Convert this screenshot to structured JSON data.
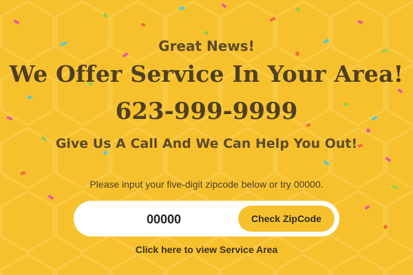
{
  "banner": {
    "pre_heading": "Great News!",
    "headline": "We Offer Service In Your Area!",
    "phone": "623-999-9999",
    "subheading": "Give Us A Call And We Can Help You Out!",
    "hint": "Please input your five-digit zipcode below or try 00000."
  },
  "zip_form": {
    "value": "00000",
    "button_label": "Check ZipCode"
  },
  "link": {
    "service_area": "Click here to view Service Area"
  },
  "colors": {
    "background": "#F7C12E",
    "text_dark": "#4E3F24",
    "input_bg": "#FFFFFF",
    "button_bg": "#F7C12E"
  }
}
